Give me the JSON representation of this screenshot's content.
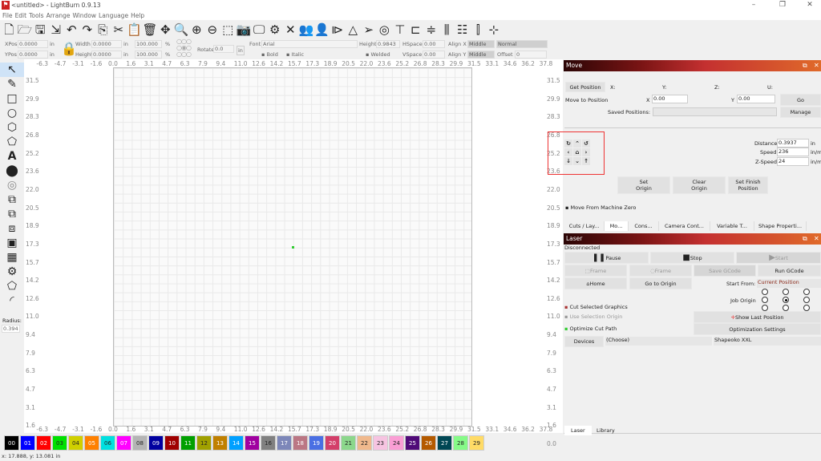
{
  "window": {
    "title": "<untitled> - LightBurn 0.9.13"
  },
  "menu": [
    "File",
    "Edit",
    "Tools",
    "Arrange",
    "Window",
    "Language",
    "Help"
  ],
  "toolbar_icons": [
    "new-file-icon",
    "open-folder-icon",
    "save-icon",
    "import-icon",
    "undo-icon",
    "redo-icon",
    "copy-icon",
    "cut-icon",
    "paste-icon",
    "delete-icon",
    "move-icon",
    "zoom-fit-icon",
    "zoom-in-icon",
    "zoom-out-icon",
    "frame-select-icon",
    "camera-icon",
    "monitor-icon",
    "settings-icon",
    "tools-icon",
    "users-icon",
    "user-icon",
    "mirror-h-icon",
    "mirror-v-icon",
    "send-icon",
    "target-icon",
    "align-top-icon",
    "align-left-icon",
    "align-hcenter-icon",
    "align-vcenter-icon",
    "distribute-h-icon",
    "distribute-v-icon",
    "center-icon"
  ],
  "props": {
    "xpos_label": "XPos",
    "xpos": "0.0000",
    "ypos_label": "YPos",
    "ypos": "0.0000",
    "unit": "in",
    "width_label": "Width",
    "width": "0.0000",
    "height_label": "Height",
    "height": "0.0000",
    "scale_w": "100.000",
    "scale_h": "100.000",
    "pct": "%",
    "rotate_label": "Rotate",
    "rotate": "0.0",
    "rotate_unit": "in",
    "font_label": "Font",
    "font": "Arial",
    "bold": "Bold",
    "italic": "Italic",
    "text_height_label": "Height",
    "text_height": "0.9843",
    "hspace_label": "HSpace",
    "hspace": "0.00",
    "vspace_label": "VSpace",
    "vspace": "0.00",
    "welded": "Welded",
    "alignx_label": "Align X",
    "alignx": "Middle",
    "aligny_label": "Align Y",
    "aligny": "Middle",
    "mode": "Normal",
    "offset_label": "Offset",
    "offset": "0"
  },
  "lefttools": {
    "radius_label": "Radius:",
    "radius": "0.394"
  },
  "ruler": {
    "x_labels": [
      "-6.3",
      "-4.7",
      "-3.1",
      "-1.6",
      "0.0",
      "1.6",
      "3.1",
      "4.7",
      "6.3",
      "7.9",
      "9.4",
      "11.0",
      "12.6",
      "14.2",
      "15.7",
      "17.3",
      "18.9",
      "20.5",
      "22.0",
      "23.6",
      "25.2",
      "26.8",
      "28.3",
      "29.9",
      "31.5",
      "33.1",
      "34.6",
      "36.2",
      "37.8"
    ],
    "y_labels": [
      "31.5",
      "29.9",
      "28.3",
      "26.8",
      "25.2",
      "23.6",
      "22.0",
      "20.5",
      "18.9",
      "17.3",
      "15.7",
      "14.2",
      "12.6",
      "11.0",
      "9.4",
      "7.9",
      "6.3",
      "4.7",
      "3.1",
      "1.6",
      "0.0"
    ]
  },
  "palette": [
    {
      "n": "00",
      "c": "#000000"
    },
    {
      "n": "01",
      "c": "#0000ff"
    },
    {
      "n": "02",
      "c": "#ff0000"
    },
    {
      "n": "03",
      "c": "#00e000"
    },
    {
      "n": "04",
      "c": "#d0d000"
    },
    {
      "n": "05",
      "c": "#ff8000"
    },
    {
      "n": "06",
      "c": "#00e0e0"
    },
    {
      "n": "07",
      "c": "#ff00ff"
    },
    {
      "n": "08",
      "c": "#b4b4b4"
    },
    {
      "n": "09",
      "c": "#0000a0"
    },
    {
      "n": "10",
      "c": "#a00000"
    },
    {
      "n": "11",
      "c": "#00a000"
    },
    {
      "n": "12",
      "c": "#a0a000"
    },
    {
      "n": "13",
      "c": "#c08000"
    },
    {
      "n": "14",
      "c": "#00a0ff"
    },
    {
      "n": "15",
      "c": "#a000a0"
    },
    {
      "n": "16",
      "c": "#808080"
    },
    {
      "n": "17",
      "c": "#7d87b9"
    },
    {
      "n": "18",
      "c": "#bb7784"
    },
    {
      "n": "19",
      "c": "#4a6fe3"
    },
    {
      "n": "20",
      "c": "#d33f6a"
    },
    {
      "n": "21",
      "c": "#8cd78c"
    },
    {
      "n": "22",
      "c": "#f0b98d"
    },
    {
      "n": "23",
      "c": "#f6c4e1"
    },
    {
      "n": "24",
      "c": "#fa9ed4"
    },
    {
      "n": "25",
      "c": "#500a78"
    },
    {
      "n": "26",
      "c": "#b45a00"
    },
    {
      "n": "27",
      "c": "#004754"
    },
    {
      "n": "28",
      "c": "#86fa88"
    },
    {
      "n": "29",
      "c": "#ffdb66"
    }
  ],
  "status": "x: 17.888, y: 13.081 in",
  "move": {
    "title": "Move",
    "get_position": "Get Position",
    "x": "X:",
    "y": "Y:",
    "z": "Z:",
    "u": "U:",
    "move_to": "Move to Position",
    "mx_label": "X",
    "mx": "0.00",
    "my_label": "Y",
    "my": "0.00",
    "go": "Go",
    "saved_label": "Saved Positions:",
    "manage": "Manage",
    "distance_label": "Distance",
    "distance": "0.3937",
    "distance_unit": "in",
    "speed_label": "Speed",
    "speed": "236",
    "speed_unit": "in/m",
    "zspeed_label": "Z-Speed",
    "zspeed": "24",
    "zspeed_unit": "in/m",
    "set_origin": "Set Origin",
    "clear_origin": "Clear Origin",
    "set_finish": "Set Finish Position",
    "machine_zero": "Move From Machine Zero",
    "jog": [
      "↻",
      "⌃",
      "↺",
      "‹",
      "⌂",
      "›",
      "↓",
      "⌄",
      "↑"
    ]
  },
  "tabs": [
    "Cuts / Lay...",
    "Mo...",
    "Cons...",
    "Camera Cont...",
    "Variable T...",
    "Shape Properti..."
  ],
  "laser": {
    "title": "Laser",
    "state": "Disconnected",
    "pause": "Pause",
    "stop": "Stop",
    "start": "Start",
    "frame1": "Frame",
    "frame2": "Frame",
    "save_gcode": "Save GCode",
    "run_gcode": "Run GCode",
    "home": "Home",
    "go_origin": "Go to Origin",
    "start_from_label": "Start From:",
    "start_from": "Current Position",
    "job_origin": "Job Origin",
    "cut_selected": "Cut Selected Graphics",
    "use_selection": "Use Selection Origin",
    "optimize": "Optimize Cut Path",
    "show_last": "Show Last Position",
    "opt_settings": "Optimization Settings",
    "devices": "Devices",
    "choose": "(Choose)",
    "device": "Shapeoko XXL"
  },
  "bottom_tabs": [
    "Laser",
    "Library"
  ]
}
